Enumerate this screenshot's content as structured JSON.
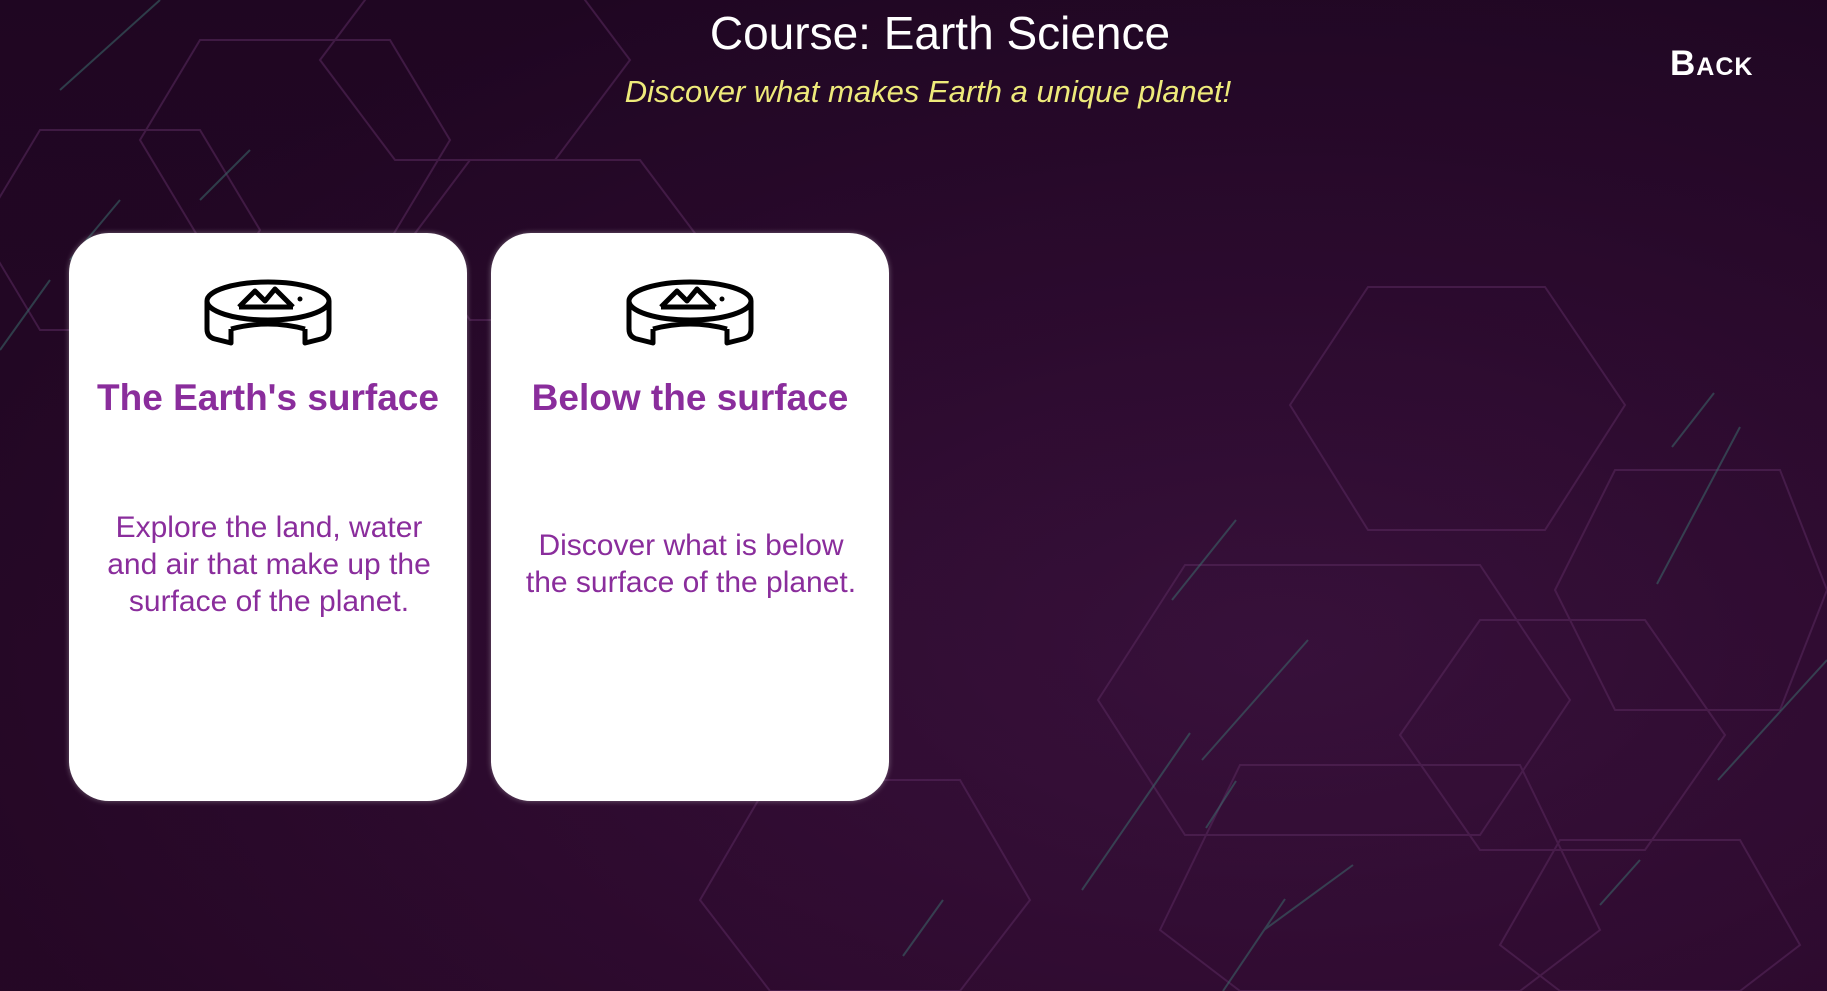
{
  "header": {
    "title": "Course: Earth Science",
    "subtitle": "Discover what makes Earth a unique planet!",
    "back_label": "Back"
  },
  "cards": [
    {
      "icon": "terrain-disc-icon",
      "title": "The Earth's surface",
      "description": "Explore the land, water and air that make up the surface of the planet."
    },
    {
      "icon": "terrain-disc-icon",
      "title": "Below the surface",
      "description": "Discover what is below the surface of the planet."
    }
  ],
  "colors": {
    "background": "#2a0a2e",
    "title": "#ffffff",
    "subtitle": "#eeea7a",
    "card_text": "#8a2d9c",
    "card_bg": "#ffffff"
  }
}
